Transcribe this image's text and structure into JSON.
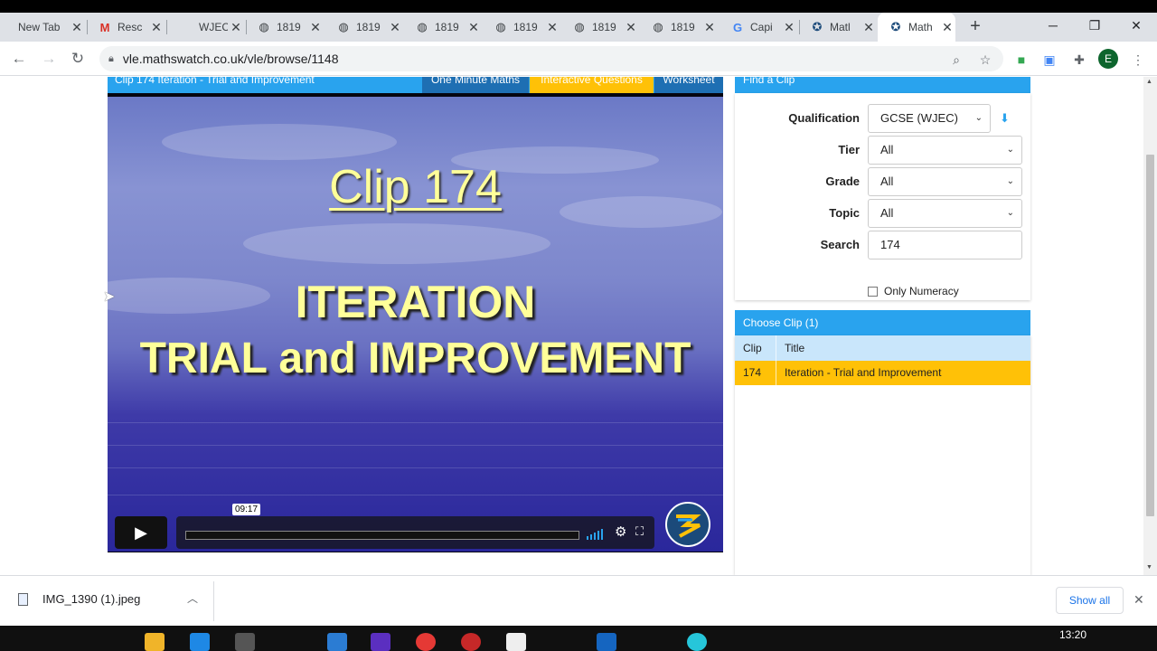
{
  "browser": {
    "tabs": [
      {
        "title": "New Tab",
        "icon": "none"
      },
      {
        "title": "Resc",
        "icon": "gmail-icon"
      },
      {
        "title": "WJEC",
        "icon": "none"
      },
      {
        "title": "1819",
        "icon": "globe-icon"
      },
      {
        "title": "1819",
        "icon": "globe-icon"
      },
      {
        "title": "1819",
        "icon": "globe-icon"
      },
      {
        "title": "1819",
        "icon": "globe-icon"
      },
      {
        "title": "1819",
        "icon": "globe-icon"
      },
      {
        "title": "1819",
        "icon": "globe-icon"
      },
      {
        "title": "Capi",
        "icon": "google-icon"
      },
      {
        "title": "Matl",
        "icon": "mathswatch-icon"
      },
      {
        "title": "Math",
        "icon": "mathswatch-icon",
        "active": true
      }
    ],
    "new_tab": "+",
    "url": "vle.mathswatch.co.uk/vle/browse/1148",
    "avatar_letter": "E"
  },
  "player": {
    "title": "Clip 174 Iteration - Trial and Improvement",
    "tabs": [
      "One Minute Maths",
      "Interactive Questions",
      "Worksheet"
    ],
    "slide_clip": "Clip 174",
    "slide_line1": "ITERATION",
    "slide_line2": "TRIAL and IMPROVEMENT",
    "timecode": "09:17",
    "progress": 0.0
  },
  "finder": {
    "title": "Find a Clip",
    "qualification_label": "Qualification",
    "qualification_value": "GCSE (WJEC)",
    "tier_label": "Tier",
    "tier_value": "All",
    "grade_label": "Grade",
    "grade_value": "All",
    "topic_label": "Topic",
    "topic_value": "All",
    "search_label": "Search",
    "search_value": "174",
    "numeracy_label": "Only Numeracy"
  },
  "choose": {
    "title": "Choose Clip (1)",
    "headers": [
      "Clip",
      "Title"
    ],
    "rows": [
      {
        "clip": "174",
        "title": "Iteration - Trial and Improvement"
      }
    ]
  },
  "downloads": {
    "file": "IMG_1390 (1).jpeg",
    "show_all": "Show all"
  },
  "taskbar": {
    "time": "13:20"
  },
  "colors": {
    "accent": "#29a3ee",
    "highlight": "#ffc107",
    "header_row": "#c9e6fb",
    "slide_text": "#ffff99"
  }
}
